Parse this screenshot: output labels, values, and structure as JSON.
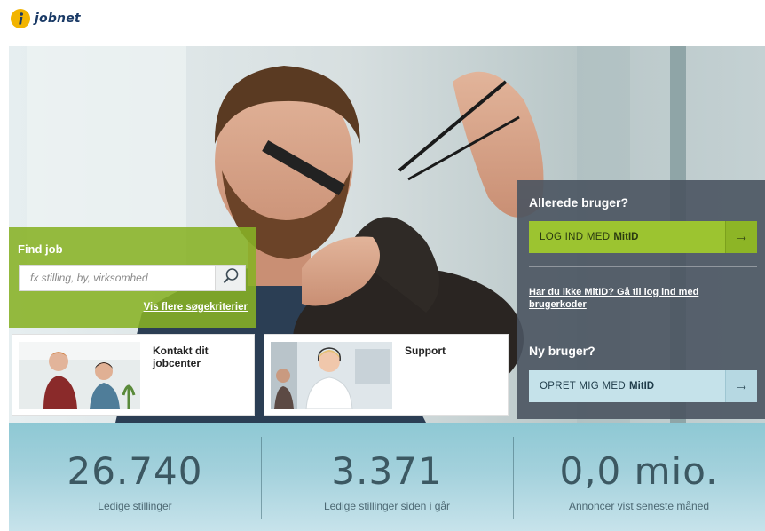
{
  "header": {
    "logo_text": "jobnet"
  },
  "find_job": {
    "title": "Find job",
    "search_placeholder": "fx stilling, by, virksomhed",
    "more_criteria_link": "Vis flere søgekriterier"
  },
  "cards": [
    {
      "title": "Kontakt dit jobcenter"
    },
    {
      "title": "Support"
    }
  ],
  "login": {
    "title": "Allerede bruger?",
    "login_button_label": "LOG IND MED",
    "mitid": "MitID",
    "alt_login_link": "Har du ikke MitID? Gå til log ind med brugerkoder"
  },
  "new_user": {
    "title": "Ny bruger?",
    "create_button_label": "OPRET MIG MED",
    "mitid": "MitID"
  },
  "stats": [
    {
      "value": "26.740",
      "label": "Ledige stillinger"
    },
    {
      "value": "3.371",
      "label": "Ledige stillinger siden i går"
    },
    {
      "value": "0,0 mio.",
      "label": "Annoncer vist seneste måned"
    }
  ],
  "icons": {
    "search": "search-icon",
    "arrow": "arrow-right-icon",
    "logo": "jobnet-logo-icon"
  },
  "colors": {
    "find_job_green": "#88b224",
    "login_button_green": "#9cc430",
    "create_button_blue": "#c5e2ea",
    "panel_dark": "#4a5460",
    "stats_band": "#a3d1dc",
    "logo_yellow": "#f2b400",
    "logo_navy": "#1a3a66"
  }
}
